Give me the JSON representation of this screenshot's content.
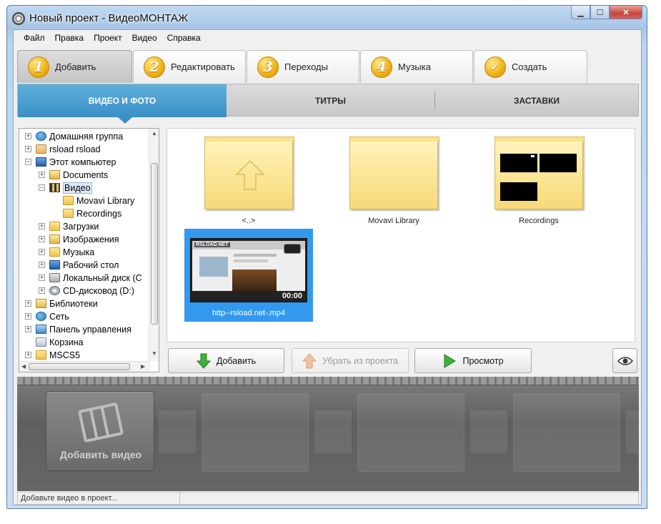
{
  "window": {
    "title": "Новый проект - ВидеоМОНТАЖ",
    "min": "▁",
    "max": "☐",
    "close": "✕"
  },
  "menu": [
    "Файл",
    "Правка",
    "Проект",
    "Видео",
    "Справка"
  ],
  "steps": [
    {
      "num": "1",
      "label": "Добавить",
      "active": true
    },
    {
      "num": "2",
      "label": "Редактировать"
    },
    {
      "num": "3",
      "label": "Переходы"
    },
    {
      "num": "4",
      "label": "Музыка"
    },
    {
      "num": "✓",
      "label": "Создать"
    }
  ],
  "subtabs": [
    "ВИДЕО И ФОТО",
    "ТИТРЫ",
    "ЗАСТАВКИ"
  ],
  "tree": [
    {
      "label": "Домашняя группа",
      "icon": "network-icon",
      "depth": 0,
      "exp": "+"
    },
    {
      "label": "rsload rsload",
      "icon": "user-folder-icon",
      "depth": 0,
      "exp": "+"
    },
    {
      "label": "Этот компьютер",
      "icon": "computer-icon",
      "depth": 0,
      "exp": "−"
    },
    {
      "label": "Documents",
      "icon": "documents-icon",
      "depth": 1,
      "exp": "+"
    },
    {
      "label": "Видео",
      "icon": "video-folder-icon",
      "depth": 1,
      "exp": "−",
      "selected": true
    },
    {
      "label": "Movavi Library",
      "icon": "folder-icon",
      "depth": 2,
      "exp": ""
    },
    {
      "label": "Recordings",
      "icon": "folder-icon",
      "depth": 2,
      "exp": ""
    },
    {
      "label": "Загрузки",
      "icon": "downloads-icon",
      "depth": 1,
      "exp": "+"
    },
    {
      "label": "Изображения",
      "icon": "pictures-icon",
      "depth": 1,
      "exp": "+"
    },
    {
      "label": "Музыка",
      "icon": "music-icon",
      "depth": 1,
      "exp": "+"
    },
    {
      "label": "Рабочий стол",
      "icon": "desktop-icon",
      "depth": 1,
      "exp": "+"
    },
    {
      "label": "Локальный диск (C",
      "icon": "disk-icon",
      "depth": 1,
      "exp": "+"
    },
    {
      "label": "CD-дисковод (D:)",
      "icon": "cd-drive-icon",
      "depth": 1,
      "exp": "+"
    },
    {
      "label": "Библиотеки",
      "icon": "libraries-icon",
      "depth": 0,
      "exp": "+"
    },
    {
      "label": "Сеть",
      "icon": "network-icon",
      "depth": 0,
      "exp": "+"
    },
    {
      "label": "Панель управления",
      "icon": "control-panel-icon",
      "depth": 0,
      "exp": "+"
    },
    {
      "label": "Корзина",
      "icon": "recycle-bin-icon",
      "depth": 0,
      "exp": ""
    },
    {
      "label": "MSCS5",
      "icon": "folder-icon",
      "depth": 0,
      "exp": "+"
    }
  ],
  "files": {
    "up_label": "<..>",
    "movavi_label": "Movavi Library",
    "recordings_label": "Recordings",
    "video_label": "http--rsload.net-.mp4",
    "video_duration": "00:00",
    "video_logo": "RSLOAD.NET"
  },
  "actions": {
    "add": "Добавить",
    "remove": "Убрать из проекта",
    "preview": "Просмотр"
  },
  "storyboard": {
    "add_video_label": "Добавить видео"
  },
  "status": {
    "text": "Добавьте видео в проект..."
  }
}
